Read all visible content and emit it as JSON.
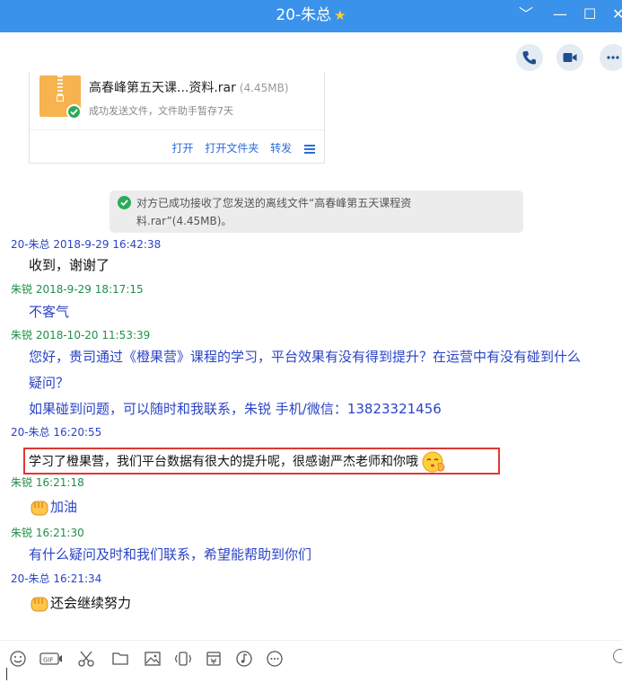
{
  "window": {
    "title": "20-朱总",
    "controls": {
      "dropdown": "﹀",
      "minimize": "—",
      "maximize": "☐",
      "close": "✕"
    }
  },
  "call_buttons": [
    "phone-icon",
    "video-icon",
    "more-icon"
  ],
  "file_card": {
    "file_name": "高春峰第五天课...资料.rar",
    "file_size": "(4.45MB)",
    "status": "成功发送文件，文件助手暂存7天",
    "actions": {
      "open": "打开",
      "open_folder": "打开文件夹",
      "forward": "转发"
    }
  },
  "system_notice": {
    "line1": "对方已成功接收了您发送的离线文件“高春峰第五天课程资",
    "line2": "料.rar”(4.45MB)。"
  },
  "messages": [
    {
      "header": "20-朱总 2018-9-29 16:42:38",
      "lines": [
        "收到，谢谢了"
      ]
    },
    {
      "header": "朱锐 2018-9-29 18:17:15",
      "lines": [
        "不客气"
      ]
    },
    {
      "header": "朱锐 2018-10-20 11:53:39",
      "lines": [
        "您好，贵司通过《橙果营》课程的学习，平台效果有没有得到提升？在运营中有没有碰到什么",
        "疑问？",
        "如果碰到问题，可以随时和我联系，朱锐 手机/微信：13823321456"
      ]
    },
    {
      "header": "20-朱总  16:20:55",
      "lines": [
        "学习了橙果营，我们平台数据有很大的提升呢，很感谢严杰老师和你哦"
      ]
    },
    {
      "header": "朱锐  16:21:18",
      "lines": [
        "加油"
      ]
    },
    {
      "header": "朱锐  16:21:30",
      "lines": [
        "有什么疑问及时和我们联系，希望能帮助到你们"
      ]
    },
    {
      "header": "20-朱总  16:21:34",
      "lines": [
        "还会继续努力"
      ]
    }
  ],
  "colors": {
    "titlebar": "#3a92ea",
    "self_name": "#2b44c6",
    "other_name": "#1f8f49",
    "highlight_border": "#e23636"
  },
  "toolbar_icons": [
    "emoji-icon",
    "gif-icon",
    "scissors-icon",
    "folder-icon",
    "image-icon",
    "shake-icon",
    "calendar-icon",
    "music-icon",
    "more-icon"
  ]
}
